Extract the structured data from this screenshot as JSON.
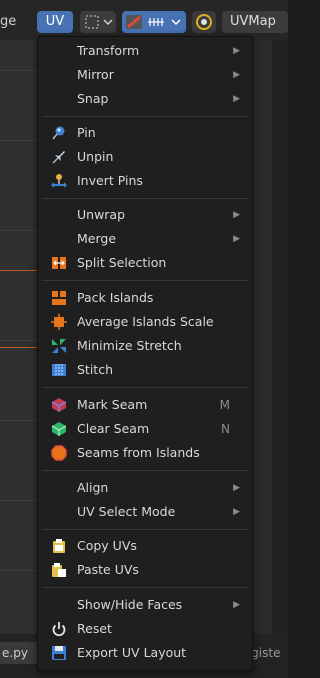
{
  "header": {
    "left_text": "ge",
    "uv_menu": "UV",
    "uvmap": "UVMap"
  },
  "background": {
    "file_label": "e.py",
    "register_label": "Registe"
  },
  "menu": {
    "transform": "Transform",
    "mirror": "Mirror",
    "snap": "Snap",
    "pin": "Pin",
    "unpin": "Unpin",
    "invert_pins": "Invert Pins",
    "unwrap": "Unwrap",
    "merge": "Merge",
    "split_selection": "Split Selection",
    "pack_islands": "Pack Islands",
    "average_islands_scale": "Average Islands Scale",
    "minimize_stretch": "Minimize Stretch",
    "stitch": "Stitch",
    "mark_seam": "Mark Seam",
    "mark_seam_shortcut": "M",
    "clear_seam": "Clear Seam",
    "clear_seam_shortcut": "N",
    "seams_from_islands": "Seams from Islands",
    "align": "Align",
    "uv_select_mode": "UV Select Mode",
    "copy_uvs": "Copy UVs",
    "paste_uvs": "Paste UVs",
    "show_hide_faces": "Show/Hide Faces",
    "reset": "Reset",
    "export_uv_layout": "Export UV Layout"
  },
  "colors": {
    "accent": "#4772b3",
    "menu_bg": "#1f1f1f",
    "text": "#d9d9d9"
  }
}
